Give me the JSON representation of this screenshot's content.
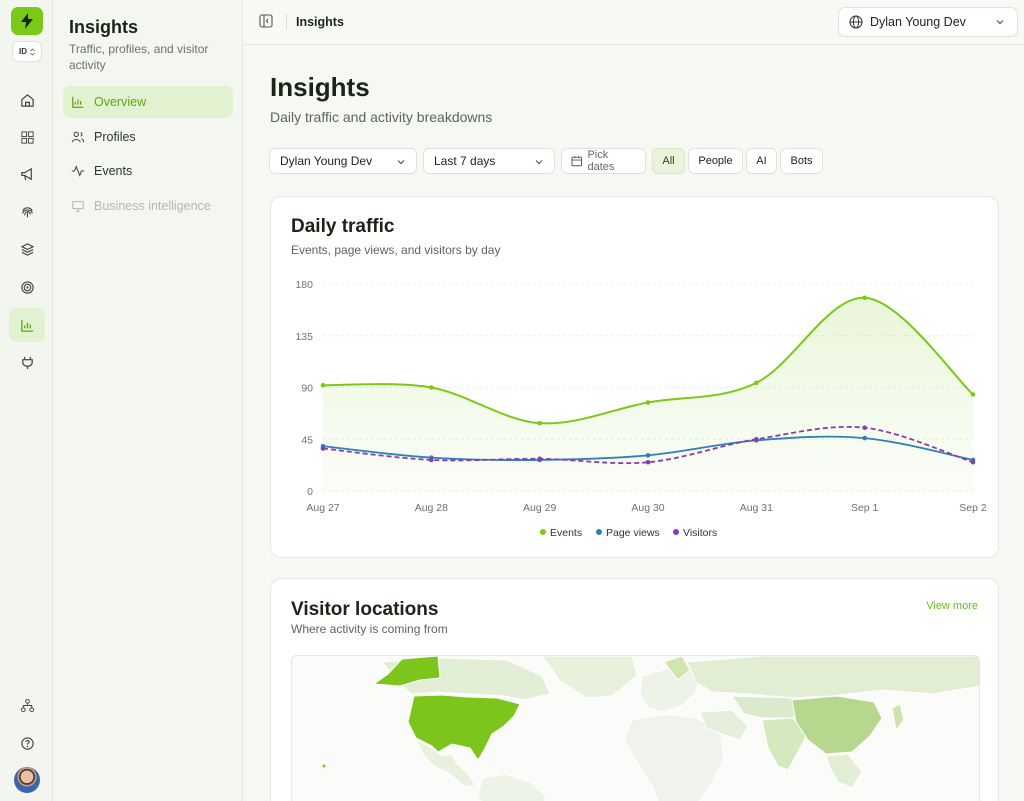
{
  "app": {
    "logo_icon": "bolt-icon",
    "workspace_badge": "ID",
    "accent": "#7ac919"
  },
  "rail": {
    "items": [
      {
        "icon": "home-icon"
      },
      {
        "icon": "grid-icon"
      },
      {
        "icon": "megaphone-icon"
      },
      {
        "icon": "fingerprint-icon"
      },
      {
        "icon": "layers-icon"
      },
      {
        "icon": "target-icon"
      },
      {
        "icon": "bar-chart-icon",
        "active": true
      },
      {
        "icon": "plug-icon"
      }
    ],
    "bottom": [
      {
        "icon": "org-chart-icon"
      },
      {
        "icon": "help-icon"
      }
    ]
  },
  "sidebar": {
    "title": "Insights",
    "subtitle": "Traffic, profiles, and visitor activity",
    "items": [
      {
        "label": "Overview",
        "icon": "bar-chart-icon",
        "active": true
      },
      {
        "label": "Profiles",
        "icon": "users-icon"
      },
      {
        "label": "Events",
        "icon": "activity-icon"
      },
      {
        "label": "Business intelligence",
        "icon": "monitor-icon",
        "disabled": true
      }
    ]
  },
  "topbar": {
    "breadcrumb": "Insights",
    "workspace": "Dylan Young Dev"
  },
  "main": {
    "title": "Insights",
    "subtitle": "Daily traffic and activity breakdowns",
    "filters": {
      "workspace": "Dylan Young Dev",
      "range": "Last 7 days",
      "pick_dates": "Pick dates",
      "segments": [
        "All",
        "People",
        "AI",
        "Bots"
      ],
      "active_segment": "All"
    }
  },
  "traffic_card": {
    "title": "Daily traffic",
    "subtitle": "Events, page views, and visitors by day"
  },
  "locations_card": {
    "title": "Visitor locations",
    "subtitle": "Where activity is coming from",
    "view_more": "View more"
  },
  "chart_data": {
    "type": "area",
    "x": [
      "Aug 27",
      "Aug 28",
      "Aug 29",
      "Aug 30",
      "Aug 31",
      "Sep 1",
      "Sep 2"
    ],
    "ylim": [
      0,
      180
    ],
    "yticks": [
      0,
      45,
      90,
      135,
      180
    ],
    "grid": true,
    "legend": "bottom",
    "series": [
      {
        "name": "Events",
        "values": [
          92,
          90,
          59,
          77,
          94,
          168,
          84
        ],
        "color": "#7ac919"
      },
      {
        "name": "Page views",
        "values": [
          39,
          29,
          27,
          31,
          44,
          46,
          27
        ],
        "color": "#2f7fb8"
      },
      {
        "name": "Visitors",
        "values": [
          37,
          27,
          28,
          25,
          45,
          55,
          25
        ],
        "color": "#8a3bb0"
      }
    ]
  }
}
